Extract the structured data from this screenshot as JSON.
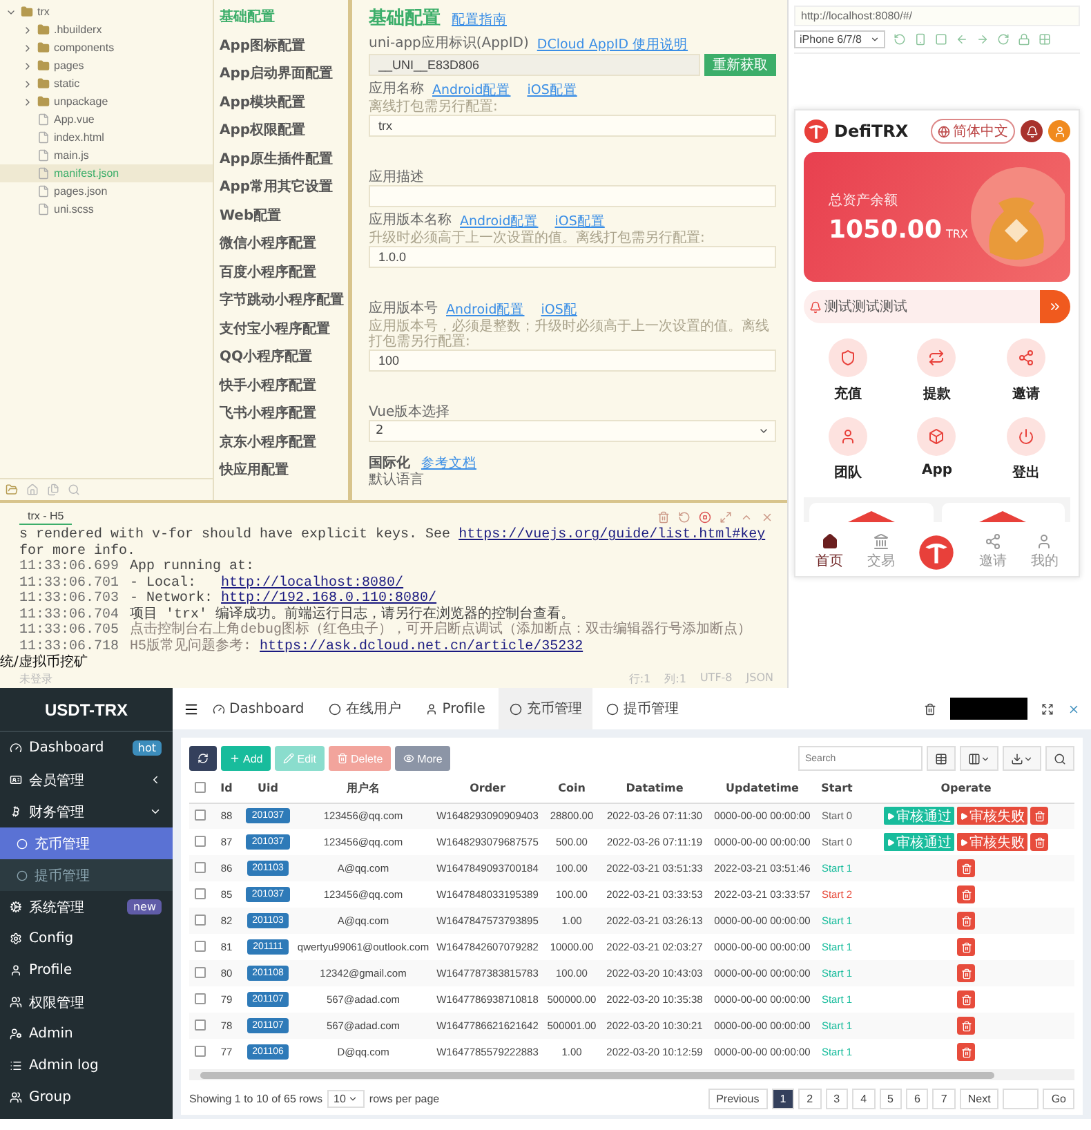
{
  "ide": {
    "file_tree": {
      "label": "trx",
      "kind": "folder",
      "expanded": true,
      "selected": false,
      "children": [
        {
          "label": ".hbuilderx",
          "kind": "folder",
          "expanded": false,
          "selected": false
        },
        {
          "label": "components",
          "kind": "folder",
          "expanded": false,
          "selected": false
        },
        {
          "label": "pages",
          "kind": "folder",
          "expanded": false,
          "selected": false
        },
        {
          "label": "static",
          "kind": "folder",
          "expanded": false,
          "selected": false
        },
        {
          "label": "unpackage",
          "kind": "folder",
          "expanded": false,
          "selected": false
        },
        {
          "label": "App.vue",
          "kind": "file",
          "selected": false
        },
        {
          "label": "index.html",
          "kind": "file",
          "selected": false
        },
        {
          "label": "main.js",
          "kind": "file",
          "selected": false
        },
        {
          "label": "manifest.json",
          "kind": "file",
          "selected": true
        },
        {
          "label": "pages.json",
          "kind": "file",
          "selected": false
        },
        {
          "label": "uni.scss",
          "kind": "file",
          "selected": false
        }
      ]
    },
    "config_menu": [
      {
        "label": "基础配置",
        "selected": true
      },
      {
        "label": "App图标配置",
        "selected": false
      },
      {
        "label": "App启动界面配置",
        "selected": false
      },
      {
        "label": "App模块配置",
        "selected": false
      },
      {
        "label": "App权限配置",
        "selected": false
      },
      {
        "label": "App原生插件配置",
        "selected": false
      },
      {
        "label": "App常用其它设置",
        "selected": false
      },
      {
        "label": "Web配置",
        "selected": false
      },
      {
        "label": "微信小程序配置",
        "selected": false
      },
      {
        "label": "百度小程序配置",
        "selected": false
      },
      {
        "label": "字节跳动小程序配置",
        "selected": false
      },
      {
        "label": "支付宝小程序配置",
        "selected": false
      },
      {
        "label": "QQ小程序配置",
        "selected": false
      },
      {
        "label": "快手小程序配置",
        "selected": false
      },
      {
        "label": "飞书小程序配置",
        "selected": false
      },
      {
        "label": "京东小程序配置",
        "selected": false
      },
      {
        "label": "快应用配置",
        "selected": false
      }
    ],
    "form": {
      "title": "基础配置",
      "guide_link": "配置指南",
      "fields": [
        {
          "kind": "input",
          "label": "uni-app应用标识(AppID)",
          "links": [
            "DCloud AppID 使用说明"
          ],
          "value": "__UNI__E83D806",
          "button": "重新获取"
        },
        {
          "kind": "input",
          "label": "应用名称",
          "hint": "离线打包需另行配置:",
          "links": [
            "Android配置",
            "iOS配置"
          ],
          "value": "trx"
        },
        {
          "kind": "input",
          "label": "应用描述"
        },
        {
          "kind": "input",
          "label": "应用版本名称",
          "hint": "升级时必须高于上一次设置的值。离线打包需另行配置:",
          "links": [
            "Android配置",
            "iOS配置"
          ],
          "value": "1.0.0"
        },
        {
          "kind": "input",
          "label": "应用版本号",
          "hint": "应用版本号，必须是整数；升级时必须高于上一次设置的值。离线打包需另行配置:",
          "links": [
            "Android配置",
            "iOS配"
          ],
          "value": "100"
        },
        {
          "kind": "select",
          "label": "Vue版本选择",
          "value": "2"
        }
      ],
      "section": {
        "title": "国际化",
        "link": "参考文档",
        "label": "默认语言"
      }
    },
    "console": {
      "tab": "trx - H5",
      "lines": [
        {
          "faint": false,
          "parts": [
            {
              "kind": "text",
              "text": "s rendered with v-for should have explicit keys. See "
            },
            {
              "kind": "link",
              "text": "https://vuejs.org/guide/list.html#key"
            },
            {
              "kind": "text",
              "text": " for more info."
            }
          ]
        },
        {
          "faint": false,
          "parts": [
            {
              "kind": "time",
              "text": "11:33:06.699"
            },
            {
              "kind": "text",
              "text": "App running at:"
            }
          ]
        },
        {
          "faint": false,
          "parts": [
            {
              "kind": "time",
              "text": "11:33:06.701"
            },
            {
              "kind": "text",
              "text": "- Local:   "
            },
            {
              "kind": "link",
              "text": "http://localhost:8080/"
            }
          ]
        },
        {
          "faint": false,
          "parts": [
            {
              "kind": "time",
              "text": "11:33:06.703"
            },
            {
              "kind": "text",
              "text": "- Network: "
            },
            {
              "kind": "link",
              "text": "http://192.168.0.110:8080/"
            }
          ]
        },
        {
          "faint": false,
          "parts": [
            {
              "kind": "time",
              "text": "11:33:06.704"
            },
            {
              "kind": "text",
              "text": "项目 'trx' 编译成功。前端运行日志，请另行在浏览器的控制台查看。"
            }
          ]
        },
        {
          "faint": true,
          "parts": [
            {
              "kind": "time",
              "text": "11:33:06.705"
            },
            {
              "kind": "text",
              "text": "点击控制台右上角debug图标（红色虫子），可开启断点调试（添加断点：双击编辑器行号添加断点）"
            }
          ]
        },
        {
          "faint": true,
          "parts": [
            {
              "kind": "time",
              "text": "11:33:06.718"
            },
            {
              "kind": "text",
              "text": "H5版常见问题参考: "
            },
            {
              "kind": "link",
              "text": "https://ask.dcloud.net.cn/article/35232"
            }
          ]
        }
      ]
    },
    "caption": "统/虚拟币挖矿",
    "status_bar": {
      "left": "未登录",
      "right": [
        "行:1",
        "列:1",
        "UTF-8",
        "JSON"
      ]
    }
  },
  "simulator": {
    "url": "http://localhost:8080/#/",
    "device": "iPhone 6/7/8",
    "app": {
      "brand": "DefiTRX",
      "language": "简体中文",
      "balance": {
        "label": "总资产余额",
        "amount": "1050.00",
        "unit": "TRX"
      },
      "notice": "测试测试测试",
      "actions": [
        {
          "label": "充值",
          "kind": "deposit"
        },
        {
          "label": "提款",
          "kind": "withdraw"
        },
        {
          "label": "邀请",
          "kind": "invite"
        },
        {
          "label": "团队",
          "kind": "team"
        },
        {
          "label": "App",
          "kind": "app"
        },
        {
          "label": "登出",
          "kind": "logout"
        }
      ],
      "tabs": [
        {
          "label": "首页",
          "kind": "home",
          "selected": true
        },
        {
          "label": "交易",
          "kind": "trade",
          "selected": false
        },
        {
          "label": "邀请",
          "kind": "invite",
          "selected": false
        },
        {
          "label": "我的",
          "kind": "me",
          "selected": false
        }
      ]
    }
  },
  "admin": {
    "brand": "USDT-TRX",
    "sidebar": [
      {
        "label": "Dashboard",
        "selected": false,
        "badge": {
          "text": "hot",
          "kind": "hot"
        }
      },
      {
        "label": "会员管理",
        "selected": false,
        "expanded": false
      },
      {
        "label": "财务管理",
        "selected": false,
        "expanded": true,
        "children": [
          {
            "label": "充币管理",
            "selected": true
          },
          {
            "label": "提币管理",
            "selected": false
          }
        ]
      },
      {
        "label": "系统管理",
        "selected": false,
        "badge": {
          "text": "new",
          "kind": "new"
        }
      },
      {
        "label": "Config",
        "selected": false
      },
      {
        "label": "Profile",
        "selected": false
      },
      {
        "label": "权限管理",
        "selected": false
      },
      {
        "label": "Admin",
        "selected": false
      },
      {
        "label": "Admin log",
        "selected": false
      },
      {
        "label": "Group",
        "selected": false
      }
    ],
    "nav_tabs": [
      {
        "label": "Dashboard",
        "selected": false
      },
      {
        "label": "在线用户",
        "selected": false
      },
      {
        "label": "Profile",
        "selected": false
      },
      {
        "label": "充币管理",
        "selected": true
      },
      {
        "label": "提币管理",
        "selected": false
      }
    ],
    "toolbar": [
      {
        "kind": "refresh",
        "disabled": false
      },
      {
        "kind": "add",
        "label": "Add",
        "disabled": false
      },
      {
        "kind": "edit",
        "label": "Edit",
        "disabled": true
      },
      {
        "kind": "delete",
        "label": "Delete",
        "disabled": true
      },
      {
        "kind": "more",
        "label": "More",
        "disabled": false
      }
    ],
    "search_placeholder": "Search",
    "header_checkbox": {
      "checked": false
    },
    "columns": [
      "Id",
      "Uid",
      "用户名",
      "Order",
      "Coin",
      "Datatime",
      "Updatetime",
      "Start",
      "Operate"
    ],
    "rows": [
      {
        "checked": false,
        "id": "88",
        "uid": "201037",
        "username": "123456@qq.com",
        "order": "W1648293090909403",
        "coin": "28800.00",
        "datatime": "2022-03-26 07:11:30",
        "updatetime": "0000-00-00 00:00:00",
        "start": "Start 0",
        "color": "#666666",
        "review_actions": [
          "审核通过",
          "审核失败"
        ]
      },
      {
        "checked": false,
        "id": "87",
        "uid": "201037",
        "username": "123456@qq.com",
        "order": "W1648293079687575",
        "coin": "500.00",
        "datatime": "2022-03-26 07:11:19",
        "updatetime": "0000-00-00 00:00:00",
        "start": "Start 0",
        "color": "#666666",
        "review_actions": [
          "审核通过",
          "审核失败"
        ]
      },
      {
        "checked": false,
        "id": "86",
        "uid": "201103",
        "username": "A@qq.com",
        "order": "W1647849093700184",
        "coin": "100.00",
        "datatime": "2022-03-21 03:51:33",
        "updatetime": "2022-03-21 03:51:46",
        "start": "Start 1",
        "color": "#18bc9c"
      },
      {
        "checked": false,
        "id": "85",
        "uid": "201037",
        "username": "123456@qq.com",
        "order": "W1647848033195389",
        "coin": "100.00",
        "datatime": "2022-03-21 03:33:53",
        "updatetime": "2022-03-21 03:33:57",
        "start": "Start 2",
        "color": "#e74c3c"
      },
      {
        "checked": false,
        "id": "82",
        "uid": "201103",
        "username": "A@qq.com",
        "order": "W1647847573793895",
        "coin": "1.00",
        "datatime": "2022-03-21 03:26:13",
        "updatetime": "0000-00-00 00:00:00",
        "start": "Start 1",
        "color": "#18bc9c"
      },
      {
        "checked": false,
        "id": "81",
        "uid": "201111",
        "username": "qwertyu99061@outlook.com",
        "order": "W1647842607079282",
        "coin": "10000.00",
        "datatime": "2022-03-21 02:03:27",
        "updatetime": "0000-00-00 00:00:00",
        "start": "Start 1",
        "color": "#18bc9c"
      },
      {
        "checked": false,
        "id": "80",
        "uid": "201108",
        "username": "12342@gmail.com",
        "order": "W1647787383815783",
        "coin": "100.00",
        "datatime": "2022-03-20 10:43:03",
        "updatetime": "0000-00-00 00:00:00",
        "start": "Start 1",
        "color": "#18bc9c"
      },
      {
        "checked": false,
        "id": "79",
        "uid": "201107",
        "username": "567@adad.com",
        "order": "W1647786938710818",
        "coin": "500000.00",
        "datatime": "2022-03-20 10:35:38",
        "updatetime": "0000-00-00 00:00:00",
        "start": "Start 1",
        "color": "#18bc9c"
      },
      {
        "checked": false,
        "id": "78",
        "uid": "201107",
        "username": "567@adad.com",
        "order": "W1647786621621642",
        "coin": "500001.00",
        "datatime": "2022-03-20 10:30:21",
        "updatetime": "0000-00-00 00:00:00",
        "start": "Start 1",
        "color": "#18bc9c"
      },
      {
        "checked": false,
        "id": "77",
        "uid": "201106",
        "username": "D@qq.com",
        "order": "W1647785579222883",
        "coin": "1.00",
        "datatime": "2022-03-20 10:12:59",
        "updatetime": "0000-00-00 00:00:00",
        "start": "Start 1",
        "color": "#18bc9c"
      }
    ],
    "pagination": {
      "summary": "Showing 1 to 10 of 65 rows",
      "page_size": "10",
      "page_size_label": "rows per page",
      "previous": "Previous",
      "pages": [
        {
          "label": "1",
          "selected": true
        },
        {
          "label": "2",
          "selected": false
        },
        {
          "label": "3",
          "selected": false
        },
        {
          "label": "4",
          "selected": false
        },
        {
          "label": "5",
          "selected": false
        },
        {
          "label": "6",
          "selected": false
        },
        {
          "label": "7",
          "selected": false
        }
      ],
      "next": "Next",
      "go": "Go"
    }
  }
}
